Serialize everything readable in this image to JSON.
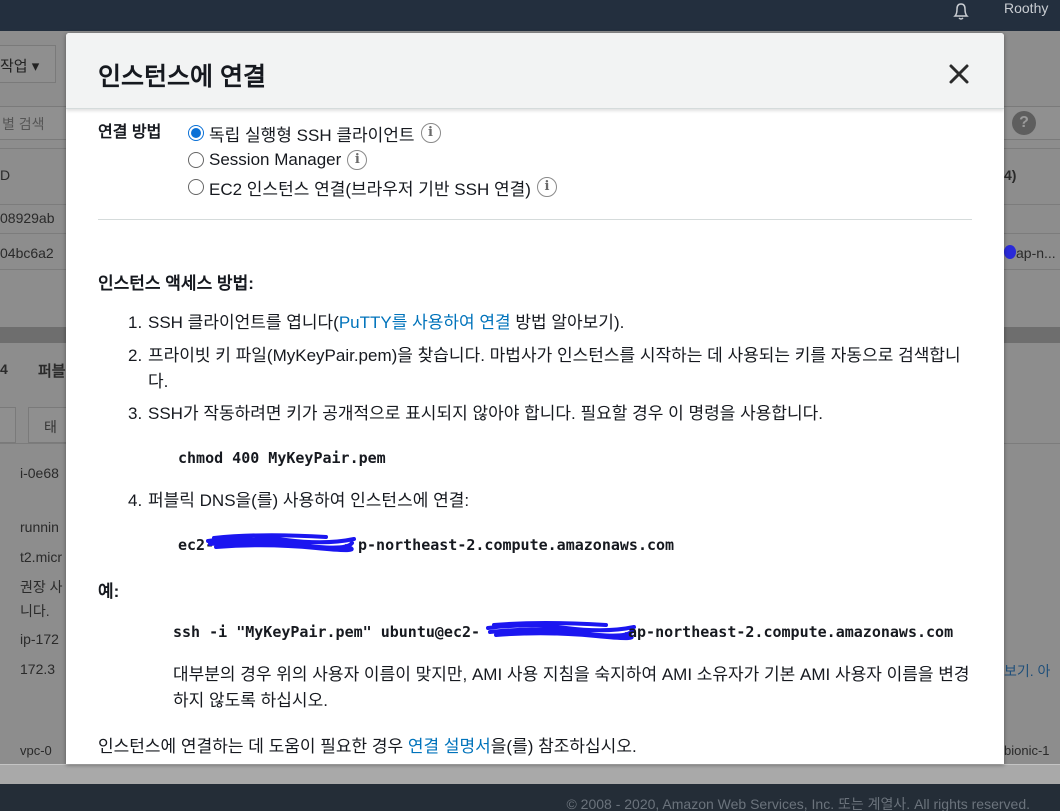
{
  "background": {
    "user_name": "Roothy",
    "action_button": "작업 ▾",
    "search_placeholder": "별 검색",
    "table_header_left": "D",
    "table_header_right": "4)",
    "row1_id": "08929ab",
    "row2_id": "04bc6a2",
    "row2_right": "ap-n...",
    "tab_left": "퍼블",
    "tab_small": "4",
    "subtab_a": "태",
    "detail_lines": [
      "i-0e68",
      "runnin",
      "t2.micr",
      "권장 사",
      "니다.",
      "ip-172",
      "172.3"
    ],
    "right_link": "보기. 아",
    "bottom_left": "vpc-0",
    "bottom_right": "bionic-1",
    "footer": "© 2008 - 2020, Amazon Web Services, Inc. 또는 계열사. All rights reserved."
  },
  "modal": {
    "title": "인스턴스에 연결",
    "method_label": "연결 방법",
    "methods": [
      {
        "label": "독립 실행형 SSH 클라이언트",
        "selected": true
      },
      {
        "label": "Session Manager",
        "selected": false
      },
      {
        "label": "EC2 인스턴스 연결(브라우저 기반 SSH 연결)",
        "selected": false
      }
    ],
    "access_heading": "인스턴스 액세스 방법:",
    "steps": {
      "s1_num": "1.",
      "s1_pre": "SSH 클라이언트를 엽니다(",
      "s1_link": "PuTTY를 사용하여 연결",
      "s1_post": " 방법 알아보기).",
      "s2_num": "2.",
      "s2_text": "프라이빗 키 파일(MyKeyPair.pem)을 찾습니다. 마법사가 인스턴스를 시작하는 데 사용되는 키를 자동으로 검색합니다.",
      "s3_num": "3.",
      "s3_text": "SSH가 작동하려면 키가 공개적으로 표시되지 않아야 합니다. 필요할 경우 이 명령을 사용합니다.",
      "s3_command": "chmod 400 MyKeyPair.pem",
      "s4_num": "4.",
      "s4_text": "퍼블릭 DNS을(를) 사용하여 인스턴스에 연결:",
      "s4_dns_prefix": "ec2-",
      "s4_dns_suffix": "p-northeast-2.compute.amazonaws.com"
    },
    "example_label": "예:",
    "example_cmd_prefix": "ssh -i \"MyKeyPair.pem\" ubuntu@ec2-",
    "example_cmd_suffix": "ap-northeast-2.compute.amazonaws.com",
    "example_note": "대부분의 경우 위의 사용자 이름이 맞지만, AMI 사용 지침을 숙지하여 AMI 소유자가 기본 AMI 사용자 이름을 변경하지 않도록 하십시오.",
    "help_pre": "인스턴스에 연결하는 데 도움이 필요한 경우 ",
    "help_link": "연결 설명서",
    "help_post": "을(를) 참조하십시오."
  },
  "colors": {
    "link": "#0073bb",
    "radio_selected": "#0a70d6",
    "redaction": "#1b16f0",
    "header_bg": "#f2f3f3"
  }
}
